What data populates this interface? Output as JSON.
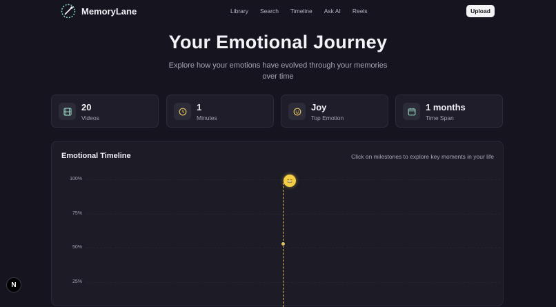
{
  "app": {
    "name": "MemoryLane"
  },
  "nav": {
    "links": [
      "Library",
      "Search",
      "Timeline",
      "Ask AI",
      "Reels"
    ],
    "upload_label": "Upload"
  },
  "hero": {
    "title": "Your Emotional Journey",
    "subtitle": "Explore how your emotions have evolved through your memories over time"
  },
  "stats": [
    {
      "value": "20",
      "label": "Videos",
      "icon": "film-icon"
    },
    {
      "value": "1",
      "label": "Minutes",
      "icon": "clock-icon"
    },
    {
      "value": "Joy",
      "label": "Top Emotion",
      "icon": "smile-icon"
    },
    {
      "value": "1 months",
      "label": "Time Span",
      "icon": "calendar-icon"
    }
  ],
  "timeline": {
    "title": "Emotional Timeline",
    "hint": "Click on milestones to explore key moments in your life",
    "y_ticks": [
      "100%",
      "75%",
      "50%",
      "25%"
    ]
  },
  "colors": {
    "background": "#16151f",
    "card": "#1e1d29",
    "accent": "#e3c15a",
    "stat_icon_tint": "#8fc9b8"
  },
  "devtools": {
    "label": "N"
  }
}
